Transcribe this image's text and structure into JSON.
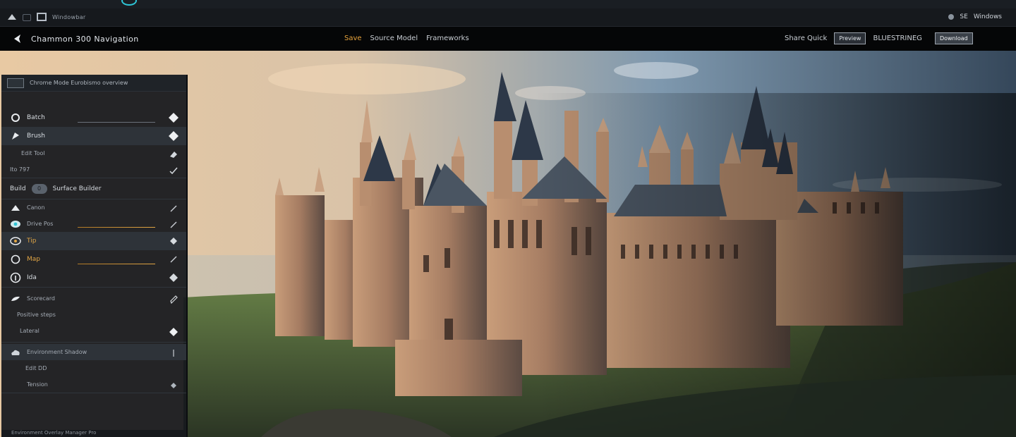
{
  "toolbar": {
    "label": "Windowbar",
    "right_status": "SE",
    "right_label": "Windows"
  },
  "navbar": {
    "title": "Chammon 300 Navigation",
    "tabs": [
      "Save",
      "Source Model",
      "Frameworks"
    ],
    "right_links": [
      "Share Quick"
    ],
    "btn_1": "Preview",
    "btn_2_label": "BLUESTRINEG",
    "btn_3": "Download"
  },
  "panel": {
    "header_label": "Chrome Mode  Eurobismo overview",
    "group1": [
      {
        "label": "Batch",
        "right": "diamond"
      },
      {
        "label": "Brush",
        "right": "diamond"
      },
      {
        "label": "Edit Tool",
        "right": "eraser"
      },
      {
        "label": "Ito 797",
        "right": "check"
      }
    ],
    "section2_title_a": "Build",
    "section2_pill": "0",
    "section2_title_b": "Surface Builder",
    "group2": [
      {
        "label": "Canon",
        "right": "slash"
      },
      {
        "label": "Drive Pos",
        "right": "slash"
      },
      {
        "label": "Tip",
        "right": "diamond"
      },
      {
        "label": "Map",
        "right": "slash"
      },
      {
        "label": "Ida",
        "right": "diamond"
      }
    ],
    "group3": [
      {
        "label": "Scorecard"
      },
      {
        "label": "Positive steps"
      },
      {
        "label": "Lateral"
      }
    ],
    "group4": [
      {
        "label": "Environment Shadow"
      },
      {
        "label": "Edit DD"
      },
      {
        "label": "Tension"
      }
    ],
    "footer": "Environment Overlay Manager Pro"
  },
  "colors": {
    "accent_amber": "#e1a645",
    "accent_cyan": "#2ec5d6",
    "panel_bg": "#17191e"
  }
}
